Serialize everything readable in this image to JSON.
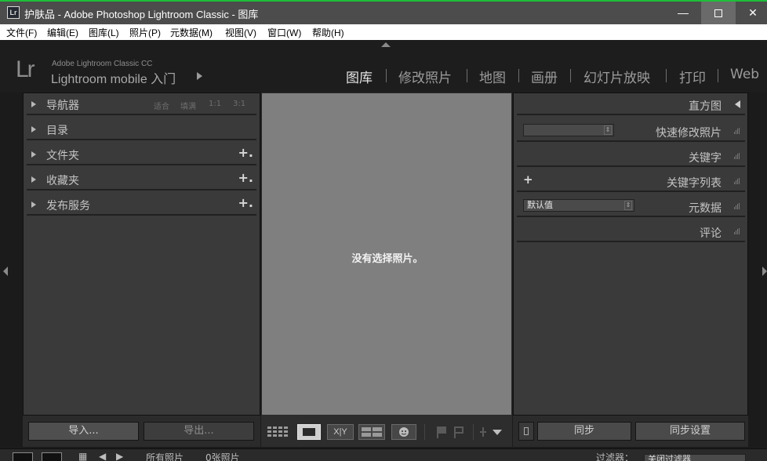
{
  "window": {
    "title": "护肤品 - Adobe Photoshop Lightroom Classic - 图库",
    "app_badge": "Lr",
    "minimize_label": "—",
    "close_label": "✕"
  },
  "menu": [
    "文件(F)",
    "编辑(E)",
    "图库(L)",
    "照片(P)",
    "元数据(M)",
    "视图(V)",
    "窗口(W)",
    "帮助(H)"
  ],
  "identity": {
    "logo": "Lr",
    "small": "Adobe Lightroom Classic CC",
    "big": "Lightroom mobile 入门"
  },
  "modules": [
    {
      "label": "图库",
      "active": true
    },
    {
      "label": "修改照片",
      "active": false
    },
    {
      "label": "地图",
      "active": false
    },
    {
      "label": "画册",
      "active": false
    },
    {
      "label": "幻灯片放映",
      "active": false
    },
    {
      "label": "打印",
      "active": false
    },
    {
      "label": "Web",
      "active": false
    }
  ],
  "left_panel": {
    "navigator": {
      "label": "导航器",
      "options": [
        "适合",
        "填满",
        "1:1",
        "3:1"
      ]
    },
    "catalog": {
      "label": "目录"
    },
    "folders": {
      "label": "文件夹",
      "plus": "+."
    },
    "collections": {
      "label": "收藏夹",
      "plus": "+."
    },
    "publish": {
      "label": "发布服务",
      "plus": "+."
    },
    "import_label": "导入...",
    "export_label": "导出..."
  },
  "center": {
    "empty_message": "没有选择照片。"
  },
  "toolbar": {
    "compare_label": "X|Y"
  },
  "right_panel": {
    "histogram": "直方图",
    "quick_develop": "快速修改照片",
    "keywording": "关键字",
    "keyword_list": "关键字列表",
    "keyword_plus": "+",
    "metadata": "元数据",
    "metadata_preset": "默认值",
    "comments": "评论",
    "sync_label": "同步",
    "sync_settings_label": "同步设置"
  },
  "filmstrip": {
    "source": "所有照片",
    "count": "0张照片",
    "filter_label": "过滤器：",
    "filter_value": "关闭过滤器"
  }
}
